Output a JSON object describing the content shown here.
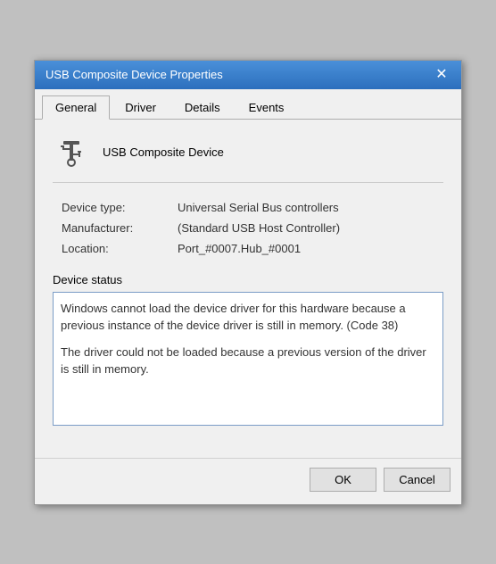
{
  "window": {
    "title": "USB Composite Device Properties",
    "close_label": "✕"
  },
  "tabs": [
    {
      "label": "General",
      "active": true
    },
    {
      "label": "Driver",
      "active": false
    },
    {
      "label": "Details",
      "active": false
    },
    {
      "label": "Events",
      "active": false
    }
  ],
  "device": {
    "name": "USB Composite Device",
    "icon": "usb-device"
  },
  "properties": [
    {
      "label": "Device type:",
      "value": "Universal Serial Bus controllers"
    },
    {
      "label": "Manufacturer:",
      "value": "(Standard USB Host Controller)"
    },
    {
      "label": "Location:",
      "value": "Port_#0007.Hub_#0001"
    }
  ],
  "status_section": {
    "label": "Device status",
    "messages": [
      "Windows cannot load the device driver for this hardware because a previous instance of the device driver is still in memory. (Code 38)",
      "The driver could not be loaded because a previous version of the driver is still in memory."
    ]
  },
  "buttons": {
    "ok_label": "OK",
    "cancel_label": "Cancel"
  }
}
